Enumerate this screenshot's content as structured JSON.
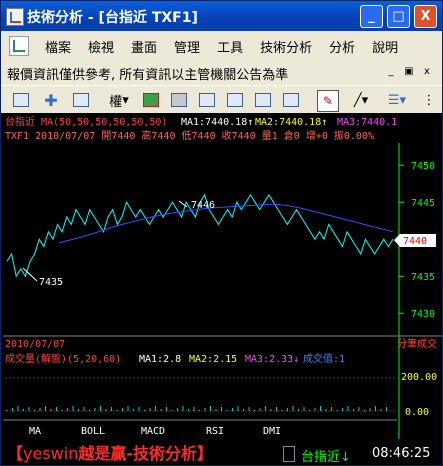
{
  "window": {
    "title": "技術分析 - [台指近 TXF1]",
    "controls": {
      "minimize": "_",
      "maximize": "□",
      "close": "X"
    }
  },
  "menu": {
    "items": [
      {
        "label": "檔案"
      },
      {
        "label": "檢視"
      },
      {
        "label": "畫面"
      },
      {
        "label": "管理"
      },
      {
        "label": "工具"
      },
      {
        "label": "技術分析"
      },
      {
        "label": "分析"
      },
      {
        "label": "說明"
      }
    ]
  },
  "notice": {
    "text": "報價資訊僅供參考, 所有資訊以主管機關公告為準",
    "controls": {
      "minimize": "_",
      "restore": "▣",
      "close": "x"
    }
  },
  "toolbar": {
    "period_label": "權"
  },
  "chart": {
    "header_line1": "台指近 MA(50,50,50,50,50,50) MA1:7440.18↑MA2:7440.18↑MA3:7440.1",
    "header_line1_parts": {
      "name": "台指近 MA(50,50,50,50,50,50)",
      "ma1": "MA1:7440.18↑",
      "ma2": "MA2:7440.18↑",
      "ma3": "MA3:7440.1"
    },
    "header_line2": "TXF1 2010/07/07 開7440 高7440 低7440 收7440 量1 倉0 增+0 振0.00%",
    "price_labels": [
      "7450",
      "7445",
      "7440",
      "7435",
      "7430"
    ],
    "current_price": "7440",
    "annotations": {
      "high": "7446",
      "low": "7435"
    },
    "date_label": "2010/07/07",
    "scale_label": "分筆成交",
    "volume_header_parts": {
      "name": "成交量(解盤)(5,20,60)",
      "ma1": "MA1:2.8",
      "ma2": "MA2:2.15",
      "ma3": "MA3:2.33↓",
      "vol": "成交值:1"
    },
    "volume_labels": [
      "200.00",
      "0.00"
    ],
    "indicator_tabs": [
      "MA",
      "BOLL",
      "MACD",
      "RSI",
      "DMI"
    ],
    "colors": {
      "price": "#00ffff",
      "ma": "#3050ff",
      "header_red": "#ff4040",
      "axis": "#00ff00",
      "ma1": "#ffffff",
      "ma2": "#ffff00",
      "ma3": "#ff40ff"
    }
  },
  "chart_data": {
    "type": "line",
    "ylim": [
      7428,
      7453
    ],
    "series": [
      {
        "values": [
          7437,
          7438,
          7435,
          7436,
          7435,
          7437,
          7438,
          7440,
          7439,
          7441,
          7440,
          7442,
          7441,
          7443,
          7442,
          7444,
          7443,
          7442,
          7444,
          7443,
          7442,
          7441,
          7443,
          7444,
          7442,
          7443,
          7445,
          7444,
          7443,
          7444,
          7443,
          7442,
          7443,
          7444,
          7443,
          7444,
          7445,
          7444,
          7443,
          7445,
          7444,
          7443,
          7445,
          7446,
          7444,
          7443,
          7442,
          7443,
          7444,
          7443,
          7445,
          7444,
          7445,
          7446,
          7445,
          7444,
          7445,
          7446,
          7445,
          7444,
          7443,
          7442,
          7443,
          7444,
          7443,
          7442,
          7441,
          7440,
          7441,
          7440,
          7442,
          7441,
          7440,
          7439,
          7441,
          7440,
          7439,
          7438,
          7440,
          7439,
          7438,
          7439,
          7440,
          7439,
          7440
        ]
      },
      {
        "values": [
          7439.5,
          7439.9,
          7440.3,
          7440.8,
          7441.3,
          7441.8,
          7442.2,
          7442.6,
          7443.0,
          7443.3,
          7443.6,
          7443.8,
          7444.0,
          7444.2,
          7444.3,
          7444.4,
          7444.5,
          7444.6,
          7444.7,
          7444.7,
          7444.5,
          7444.2,
          7443.8,
          7443.4,
          7443.0,
          7442.6,
          7442.2,
          7441.8,
          7441.4,
          7441.0
        ]
      }
    ]
  },
  "status": {
    "banner_en": "yeswin",
    "banner_zh": "越是贏-技術分析",
    "open_bracket": "【",
    "close_bracket": "】",
    "symbol": "台指近↓",
    "time": "08:46:25"
  }
}
